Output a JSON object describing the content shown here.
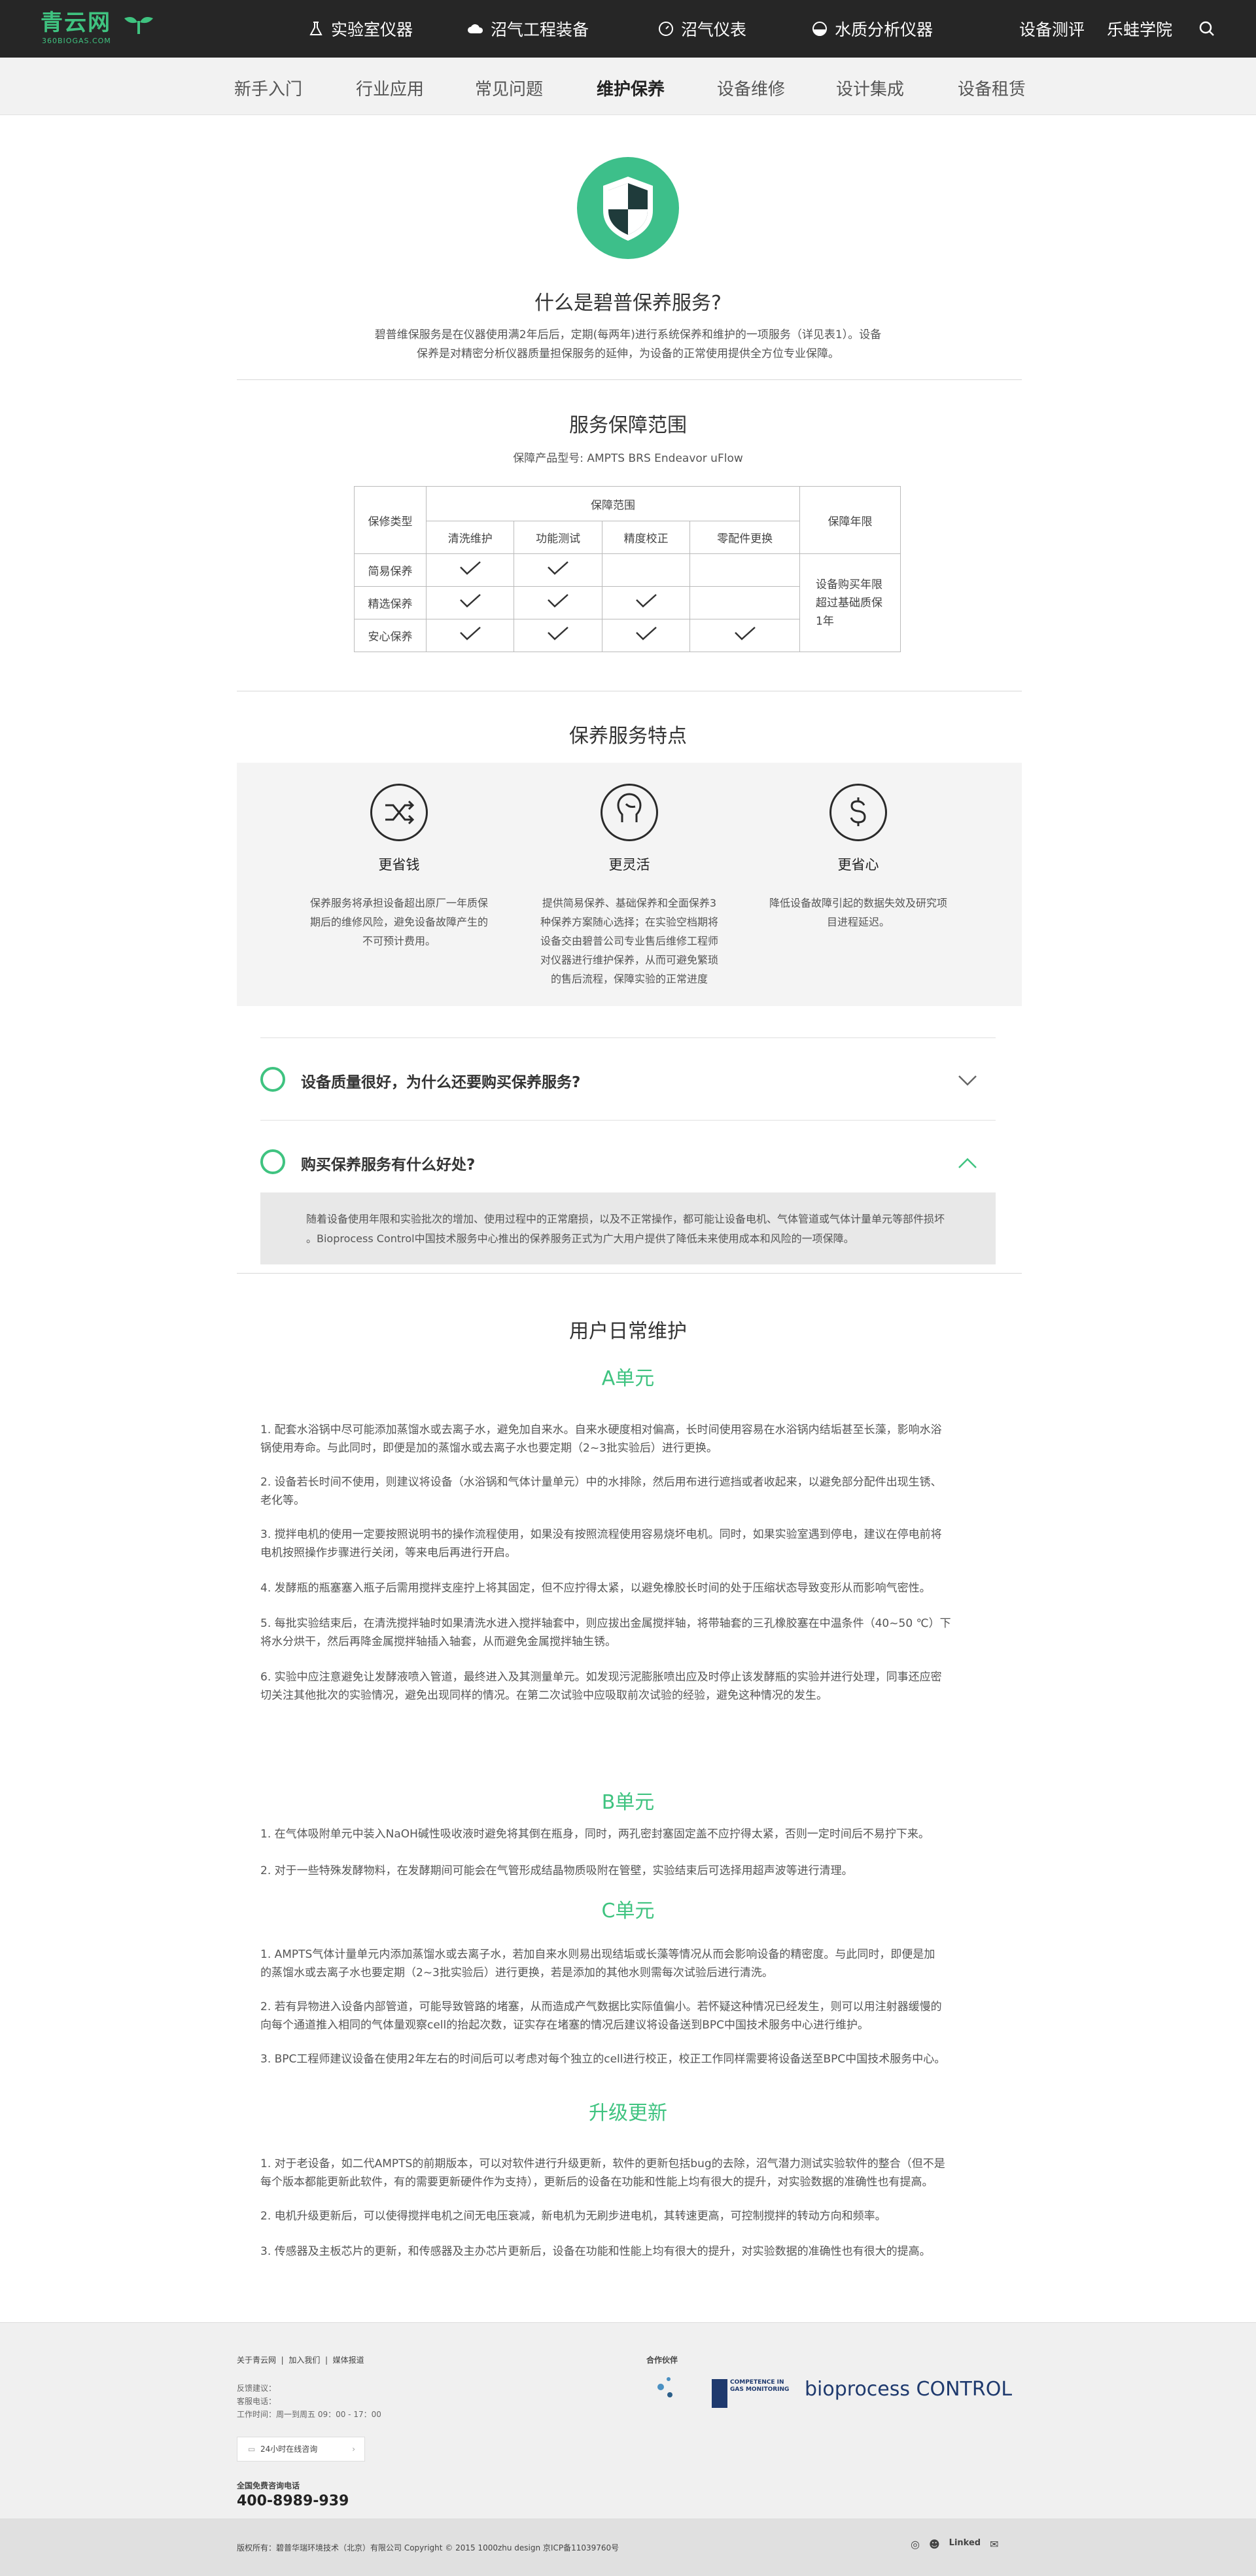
{
  "header": {
    "logo_text": "青云网",
    "logo_sub": "360BIOGAS.COM",
    "nav": [
      {
        "label": "实验室仪器",
        "icon": "flask-icon"
      },
      {
        "label": "沼气工程装备",
        "icon": "cloud-icon"
      },
      {
        "label": "沼气仪表",
        "icon": "gauge-icon"
      },
      {
        "label": "水质分析仪器",
        "icon": "water-icon"
      }
    ],
    "right_links": [
      "设备测评",
      "乐蛙学院"
    ]
  },
  "subnav": {
    "items": [
      "新手入门",
      "行业应用",
      "常见问题",
      "维护保养",
      "设备维修",
      "设计集成",
      "设备租赁"
    ],
    "active": "维护保养"
  },
  "intro": {
    "title": "什么是碧普保养服务?",
    "text_line1": "碧普维保服务是在仪器使用满2年后后，定期(每两年)进行系统保养和维护的一项服务（详见表1）。设备",
    "text_line2": "保养是对精密分析仪器质量担保服务的延伸，为设备的正常使用提供全方位专业保障。"
  },
  "scope": {
    "title": "服务保障范围",
    "models": "保障产品型号: AMPTS  BRS  Endeavor  uFlow",
    "col_type": "保修类型",
    "col_range": "保障范围",
    "col_term": "保障年限",
    "sub_cols": [
      "清洗维护",
      "功能测试",
      "精度校正",
      "零配件更换"
    ],
    "rows": [
      {
        "name": "简易保养",
        "checks": [
          true,
          true,
          false,
          false
        ]
      },
      {
        "name": "精选保养",
        "checks": [
          true,
          true,
          true,
          false
        ]
      },
      {
        "name": "安心保养",
        "checks": [
          true,
          true,
          true,
          true
        ]
      }
    ],
    "term_text": "设备购买年限超过基础质保1年"
  },
  "features": {
    "title": "保养服务特点",
    "items": [
      {
        "title": "更省钱",
        "icon": "shuffle-icon",
        "lines": [
          "保养服务将承担设备超出原厂一年质保",
          "期后的维修风险，避免设备故障产生的",
          "不可预计费用。"
        ]
      },
      {
        "title": "更灵活",
        "icon": "user-icon",
        "lines": [
          "提供简易保养、基础保养和全面保养3",
          "种保养方案随心选择；在实验空档期将",
          "设备交由碧普公司专业售后维修工程师",
          "对仪器进行维护保养，从而可避免繁琐",
          "的售后流程，保障实验的正常进度"
        ]
      },
      {
        "title": "更省心",
        "icon": "dollar-icon",
        "lines": [
          "降低设备故障引起的数据失效及研究项",
          "目进程延迟。"
        ]
      }
    ]
  },
  "faq": [
    {
      "q": "设备质量很好，为什么还要购买保养服务?",
      "open": false
    },
    {
      "q": "购买保养服务有什么好处?",
      "open": true,
      "a_line1": "随着设备使用年限和实验批次的增加、使用过程中的正常磨损，以及不正常操作，都可能让设备电机、气体管道或气体计量单元等部件损坏",
      "a_line2": "。Bioprocess Control中国技术服务中心推出的保养服务正式为广大用户提供了降低未来使用成本和风险的一项保障。"
    }
  ],
  "daily": {
    "title": "用户日常维护",
    "units": [
      {
        "title": "A单元",
        "items": [
          [
            "1.    配套水浴锅中尽可能添加蒸馏水或去离子水，避免加自来水。自来水硬度相对偏高，长时间使用容易在水浴锅内结垢甚至长藻，影响水浴",
            "锅使用寿命。与此同时，即便是加的蒸馏水或去离子水也要定期（2~3批实验后）进行更换。"
          ],
          [
            "2.    设备若长时间不使用，则建议将设备（水浴锅和气体计量单元）中的水排除，然后用布进行遮挡或者收起来，以避免部分配件出现生锈、",
            "老化等。"
          ],
          [
            "3.    搅拌电机的使用一定要按照说明书的操作流程使用，如果没有按照流程使用容易烧坏电机。同时，如果实验室遇到停电，建议在停电前将",
            "电机按照操作步骤进行关闭，等来电后再进行开启。"
          ],
          [
            "4.    发酵瓶的瓶塞塞入瓶子后需用搅拌支座拧上将其固定，但不应拧得太紧，以避免橡胶长时间的处于压缩状态导致变形从而影响气密性。"
          ],
          [
            "5.    每批实验结束后，在清洗搅拌轴时如果清洗水进入搅拌轴套中，则应拔出金属搅拌轴，将带轴套的三孔橡胶塞在中温条件（40~50 ℃）下",
            "将水分烘干，然后再降金属搅拌轴插入轴套，从而避免金属搅拌轴生锈。"
          ],
          [
            "6.    实验中应注意避免让发酵液喷入管道，最终进入及其测量单元。如发现污泥膨胀喷出应及时停止该发酵瓶的实验并进行处理，同事还应密",
            "切关注其他批次的实验情况，避免出现同样的情况。在第二次试验中应吸取前次试验的经验，避免这种情况的发生。"
          ]
        ]
      },
      {
        "title": "B单元",
        "items": [
          [
            "1.    在气体吸附单元中装入NaOH碱性吸收液时避免将其倒在瓶身，同时，两孔密封塞固定盖不应拧得太紧，否则一定时间后不易拧下来。"
          ],
          [
            "2.    对于一些特殊发酵物料，在发酵期间可能会在气管形成结晶物质吸附在管壁，实验结束后可选择用超声波等进行清理。"
          ]
        ]
      },
      {
        "title": "C单元",
        "items": [
          [
            "1.    AMPTS气体计量单元内添加蒸馏水或去离子水，若加自来水则易出现结垢或长藻等情况从而会影响设备的精密度。与此同时，即便是加",
            "的蒸馏水或去离子水也要定期（2~3批实验后）进行更换，若是添加的其他水则需每次试验后进行清洗。"
          ],
          [
            "2.    若有异物进入设备内部管道，可能导致管路的堵塞，从而造成产气数据比实际值偏小。若怀疑这种情况已经发生，则可以用注射器缓慢的",
            "向每个通道推入相同的气体量观察cell的抬起次数，证实存在堵塞的情况后建议将设备送到BPC中国技术服务中心进行维护。"
          ],
          [
            "3.    BPC工程师建议设备在使用2年左右的时间后可以考虑对每个独立的cell进行校正，校正工作同样需要将设备送至BPC中国技术服务中心。"
          ]
        ]
      },
      {
        "title": "升级更新",
        "items": [
          [
            "1.    对于老设备，如二代AMPTS的前期版本，可以对软件进行升级更新，软件的更新包括bug的去除，沼气潜力测试实验软件的整合（但不是",
            "每个版本都能更新此软件，有的需要更新硬件作为支持），更新后的设备在功能和性能上均有很大的提升，对实验数据的准确性也有提高。"
          ],
          [
            "2.    电机升级更新后，可以使得搅拌电机之间无电压衰减，新电机为无刷步进电机，其转速更高，可控制搅拌的转动方向和频率。"
          ],
          [
            "3.    传感器及主板芯片的更新，和传感器及主办芯片更新后，设备在功能和性能上均有很大的提升，对实验数据的准确性也有很大的提高。"
          ]
        ]
      }
    ]
  },
  "footer": {
    "links": [
      "关于青云网",
      "加入我们",
      "媒体报道"
    ],
    "contact_lines": [
      "反馈建议：",
      "客服电话：",
      "工作时间：周一到周五 09：00 - 17：00"
    ],
    "online_label": "24小时在线咨询",
    "hotline_label": "全国免费咨询电话",
    "hotline": "400-8989-939",
    "partners_label": "合作伙伴",
    "partners": [
      "Anaconda",
      "COMPETENCE IN GAS MONITORING",
      "bioprocess CONTROL"
    ],
    "copyright": "版权所有：碧普华瑞环境技术（北京）有限公司    Copyright © 2015 1000zhu design 京ICP备11039760号"
  }
}
